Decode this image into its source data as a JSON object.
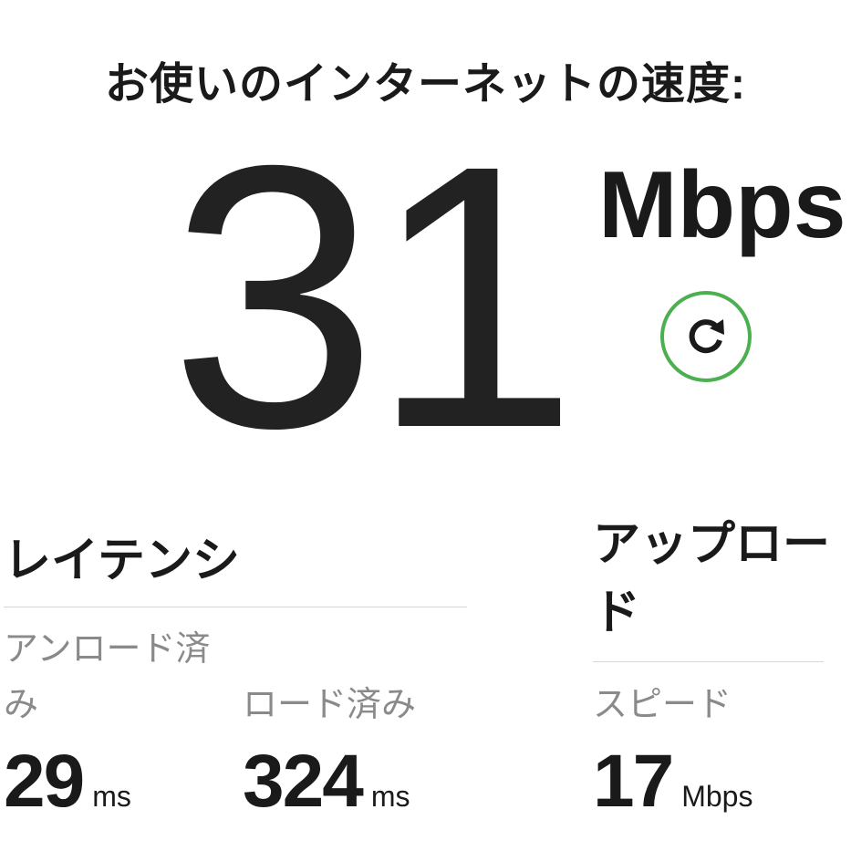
{
  "header": {
    "title": "お使いのインターネットの速度:"
  },
  "speed": {
    "value": "31",
    "units": "Mbps"
  },
  "refresh": {
    "icon": "refresh-icon",
    "accent_color": "#4caf50"
  },
  "latency": {
    "heading": "レイテンシ",
    "unloaded": {
      "label": "アンロード済み",
      "value": "29",
      "unit": "ms"
    },
    "loaded": {
      "label": "ロード済み",
      "value": "324",
      "unit": "ms"
    }
  },
  "upload": {
    "heading": "アップロード",
    "speed": {
      "label": "スピード",
      "value": "17",
      "unit": "Mbps"
    }
  }
}
